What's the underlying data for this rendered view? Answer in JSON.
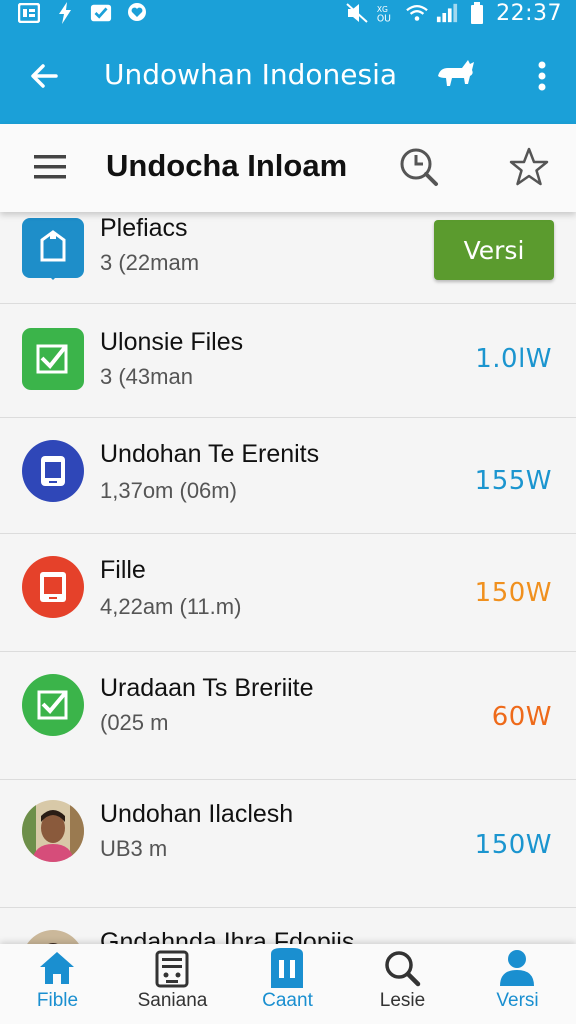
{
  "status_bar": {
    "time": "22:37",
    "icons": [
      "sim-card-icon",
      "flash-icon",
      "message-icon",
      "heart-location-icon",
      "mute-icon",
      "vibrate-icon",
      "wifi-icon",
      "signal-icon",
      "battery-icon"
    ]
  },
  "app_bar": {
    "title": "Undowhan Indonesia",
    "icons": [
      "back-arrow-icon",
      "animal-icon",
      "more-vert-icon"
    ]
  },
  "toolbar": {
    "title": "Undocha Inloam",
    "icons": [
      "menu-icon",
      "history-search-icon",
      "star-icon"
    ]
  },
  "list": {
    "items": [
      {
        "name": "Plefiacs",
        "sub": "3 (22mam",
        "button": "Versi",
        "icon": "shop-bag-icon",
        "icon_color": "#1e8ec9"
      },
      {
        "name": "Ulonsie Files",
        "sub": "3 (43man",
        "value": "1.0lW",
        "value_color": "#1b95cf",
        "icon": "checkbox-icon",
        "icon_color": "#3bb44a"
      },
      {
        "name": "Undohan Te Erenits",
        "sub": "1,37om (06m)",
        "value": "155W",
        "value_color": "#1b95cf",
        "icon": "tablet-icon",
        "icon_color": "#2f47b8"
      },
      {
        "name": "Fille",
        "sub": "4,22am (11.m)",
        "value": "150W",
        "value_color": "#f0901e",
        "icon": "tablet-icon",
        "icon_color": "#e5412a"
      },
      {
        "name": "Uradaan Ts Breriite",
        "sub": "(025 m",
        "value": "60W",
        "value_color": "#ee6a1a",
        "icon": "checkbox-icon",
        "icon_color": "#3bb44a"
      },
      {
        "name": "Undohan Ilaclesh",
        "sub": "UB3 m",
        "value": "150W",
        "value_color": "#1b95cf",
        "icon": "avatar-photo-icon",
        "icon_color": "#8a5a3c"
      },
      {
        "name": "Gndahnda Ihra Fdopiis",
        "sub": "",
        "value": "",
        "icon": "avatar-photo-icon",
        "icon_color": "#3a2a22"
      }
    ]
  },
  "bottom_nav": {
    "items": [
      {
        "label": "Fible",
        "icon": "home-icon"
      },
      {
        "label": "Saniana",
        "icon": "robot-icon"
      },
      {
        "label": "Caant",
        "icon": "pause-icon"
      },
      {
        "label": "Lesie",
        "icon": "search-icon"
      },
      {
        "label": "Versi",
        "icon": "person-icon"
      }
    ],
    "accent_color": "#1a8fd0"
  }
}
